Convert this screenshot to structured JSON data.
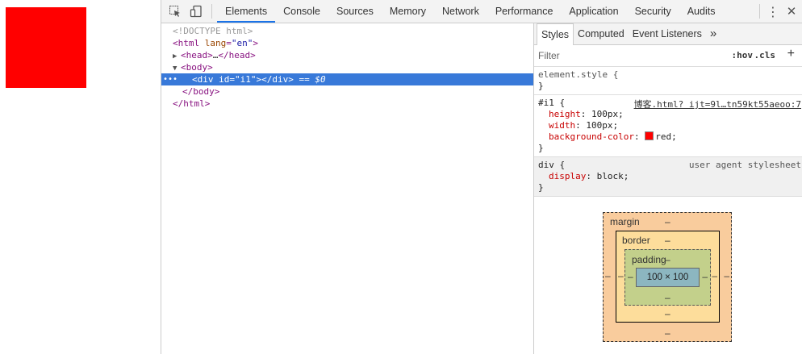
{
  "page": {
    "box_color": "#ff0000"
  },
  "toolbar": {
    "inspect_icon": "element-picker-icon",
    "device_icon": "device-toolbar-icon",
    "tabs": [
      "Elements",
      "Console",
      "Sources",
      "Memory",
      "Network",
      "Performance",
      "Application",
      "Security",
      "Audits"
    ],
    "active_tab": "Elements",
    "menu_glyph": "⋮",
    "close_glyph": "✕"
  },
  "dom": {
    "doctype": "<!DOCTYPE html>",
    "html_open_tag": "<html",
    "html_lang_attr": "lang",
    "html_lang_value": "\"en\"",
    "html_open_close": ">",
    "head_open": "<head>",
    "head_ellipsis": "…",
    "head_close": "</head>",
    "body_open": "<body>",
    "div_open": "<div",
    "div_id_attr": "id",
    "div_id_value": "\"i1\"",
    "div_open_close": "></div>",
    "dollar_zero": " == $0",
    "body_close": "</body>",
    "html_close": "</html>",
    "dots": "•••"
  },
  "styles": {
    "tabs": [
      "Styles",
      "Computed",
      "Event Listeners"
    ],
    "more_tabs_glyph": "»",
    "filter_placeholder": "Filter",
    "hov": ":hov",
    "cls": ".cls",
    "plus": "+",
    "rules": [
      {
        "selector": "element.style {",
        "close": "}",
        "props": []
      },
      {
        "selector": "#i1 {",
        "source": "博客.html? ijt=9l…tn59kt55aeoo:7",
        "close": "}",
        "props": [
          {
            "name": "height",
            "value": "100px;"
          },
          {
            "name": "width",
            "value": "100px;"
          },
          {
            "name": "background-color",
            "value": "red;"
          }
        ]
      },
      {
        "selector": "div {",
        "source": "user agent stylesheet",
        "close": "}",
        "props": [
          {
            "name": "display",
            "value": "block;"
          }
        ]
      }
    ]
  },
  "box_model": {
    "margin_label": "margin",
    "border_label": "border",
    "padding_label": "padding",
    "content": "100 × 100",
    "dash": "–"
  }
}
